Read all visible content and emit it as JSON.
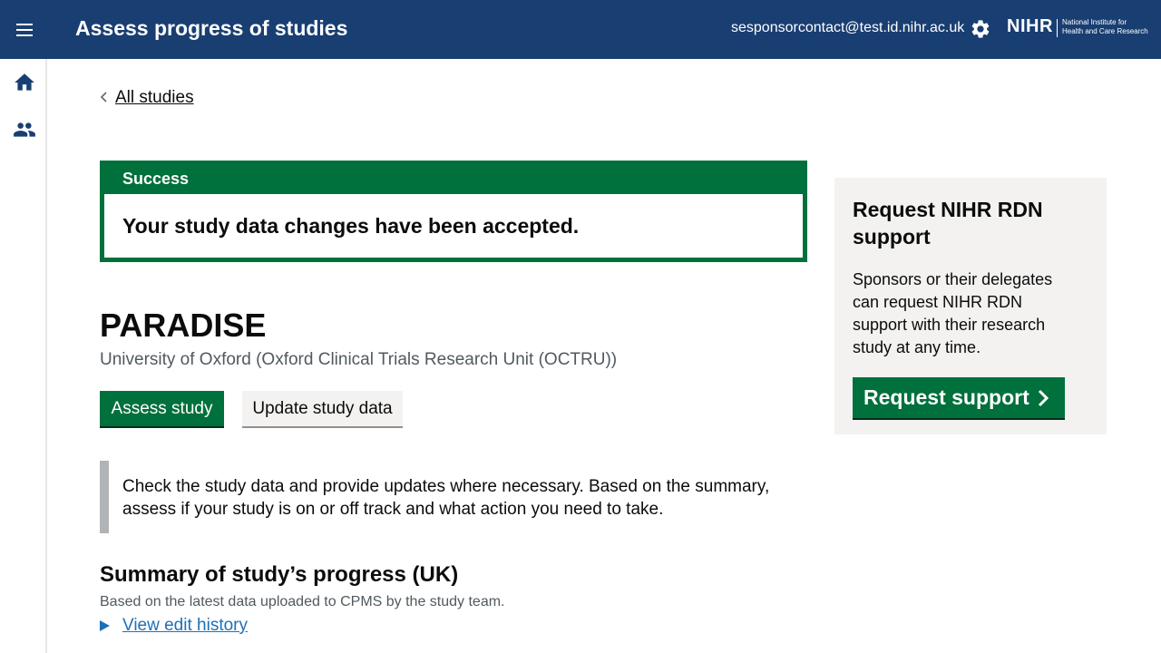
{
  "header": {
    "app_title": "Assess progress of studies",
    "user_email": "sesponsorcontact@test.id.nihr.ac.uk",
    "logo": {
      "mark": "NIHR",
      "text_line1": "National Institute for",
      "text_line2": "Health and Care Research"
    },
    "icons": {
      "menu": "menu-icon",
      "settings": "gear-icon"
    }
  },
  "sidebar": {
    "items": [
      {
        "icon": "home-icon"
      },
      {
        "icon": "users-icon"
      }
    ]
  },
  "main": {
    "back_link": "All studies",
    "banner": {
      "title": "Success",
      "message": "Your study data changes have been accepted."
    },
    "study": {
      "title": "PARADISE",
      "organisation": "University of Oxford (Oxford Clinical Trials Research Unit (OCTRU))"
    },
    "buttons": {
      "assess": "Assess study",
      "update": "Update study data"
    },
    "inset_text": "Check the study data and provide updates where necessary. Based on the summary, assess if your study is on or off track and what action you need to take.",
    "summary": {
      "heading": "Summary of study’s progress (UK)",
      "caption": "Based on the latest data uploaded to CPMS by the study team.",
      "details_label": "View edit history"
    }
  },
  "aside": {
    "heading": "Request NIHR RDN support",
    "text": "Sponsors or their delegates can request NIHR RDN support with their research study at any time.",
    "button": "Request support"
  },
  "colors": {
    "header_bg": "#193e72",
    "success_green": "#00703c",
    "link_blue": "#1d70b8",
    "aside_bg": "#f3f2f1"
  }
}
